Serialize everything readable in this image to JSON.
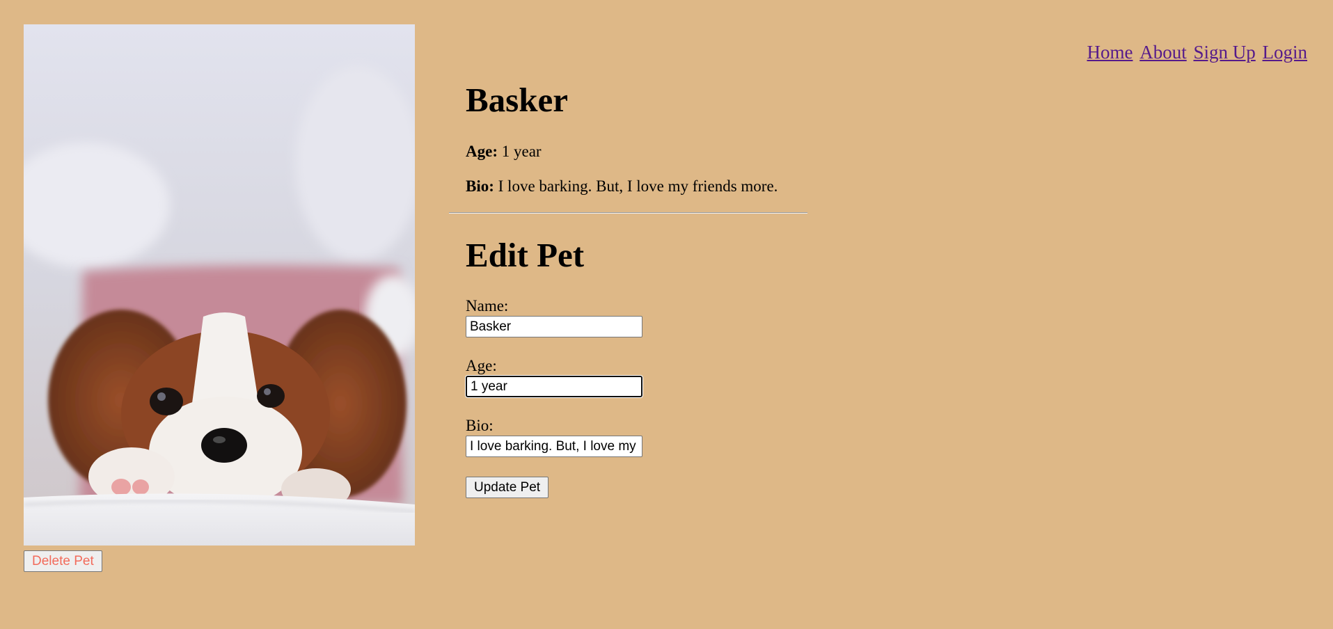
{
  "nav": {
    "links": [
      "Home",
      "About",
      "Sign Up",
      "Login"
    ],
    "link_color": "#551a8b"
  },
  "pet": {
    "name": "Basker",
    "age_label": "Age:",
    "age": "1 year",
    "bio_label": "Bio:",
    "bio": "I love barking. But, I love my friends more."
  },
  "photo": {
    "subject": "puppy-photo"
  },
  "actions": {
    "delete_label": "Delete Pet",
    "delete_color": "#f26b5b"
  },
  "edit_form": {
    "title": "Edit Pet",
    "name_label": "Name:",
    "name_value": "Basker",
    "age_label": "Age:",
    "age_value": "1 year",
    "bio_label": "Bio:",
    "bio_value": "I love barking. But, I love my friends more.",
    "submit_label": "Update Pet"
  },
  "theme": {
    "background": "#deb887"
  }
}
